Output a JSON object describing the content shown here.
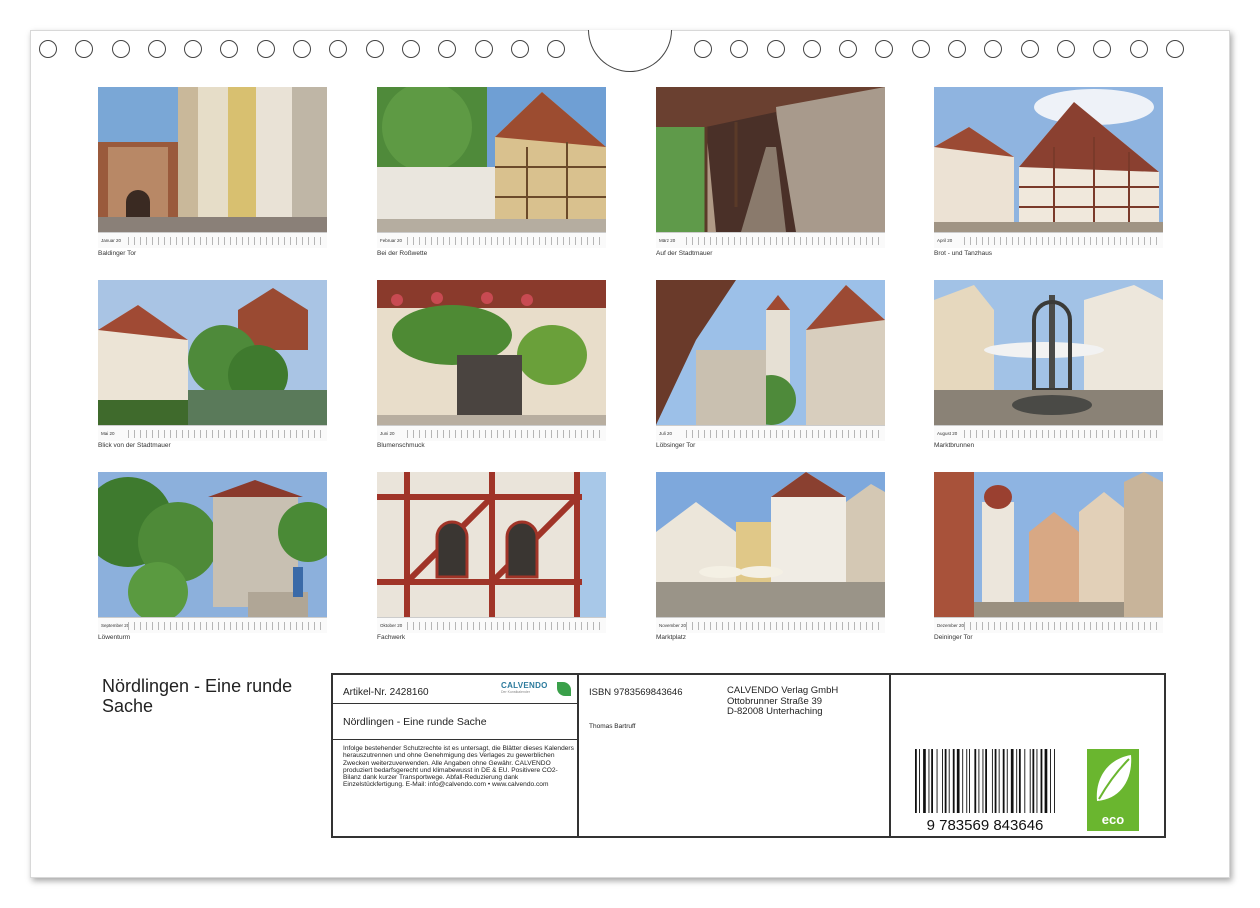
{
  "calendar": {
    "title": "Nördlingen - Eine runde Sache",
    "photos": [
      {
        "caption": "Baldinger Tor",
        "month": "Januar 20"
      },
      {
        "caption": "Bei der Roßwette",
        "month": "Februar 20"
      },
      {
        "caption": "Auf der Stadtmauer",
        "month": "März 20"
      },
      {
        "caption": "Brot - und Tanzhaus",
        "month": "April 20"
      },
      {
        "caption": "Blick von der Stadtmauer",
        "month": "Mai 20"
      },
      {
        "caption": "Blumenschmuck",
        "month": "Juni 20"
      },
      {
        "caption": "Löbsinger Tor",
        "month": "Juli 20"
      },
      {
        "caption": "Marktbrunnen",
        "month": "August 20"
      },
      {
        "caption": "Löwenturm",
        "month": "September 20"
      },
      {
        "caption": "Fachwerk",
        "month": "Oktober 20"
      },
      {
        "caption": "Marktplatz",
        "month": "November 20"
      },
      {
        "caption": "Deininger Tor",
        "month": "Dezember 20"
      }
    ]
  },
  "info": {
    "article_number": "Artikel-Nr. 2428160",
    "logo_text": "CALVENDO",
    "logo_subtext": "Der Kunstkalender",
    "subtitle": "Nördlingen - Eine runde Sache",
    "legal_text": "Infolge bestehender Schutzrechte ist es untersagt, die Blätter dieses Kalenders herauszutrennen und ohne Genehmigung des Verlages zu gewerblichen Zwecken weiterzuverwenden. Alle Angaben ohne Gewähr. CALVENDO produziert bedarfsgerecht und klimabewusst in DE & EU. Positivere CO2-Bilanz dank kurzer Transportwege. Abfall-Reduzierung dank Einzelstückfertigung. E-Mail: info@calvendo.com • www.calvendo.com",
    "isbn": "ISBN 9783569843646",
    "author": "Thomas Bartruff",
    "publisher_name": "CALVENDO Verlag GmbH",
    "publisher_street": "Ottobrunner Straße 39",
    "publisher_city": "D-82008 Unterhaching",
    "barcode_digits": "9 783569 843646",
    "eco_label": "eco"
  },
  "colors": {
    "calvendo_blue": "#2b7a9c",
    "eco_green": "#6ab62f",
    "frame_border": "#333333"
  }
}
